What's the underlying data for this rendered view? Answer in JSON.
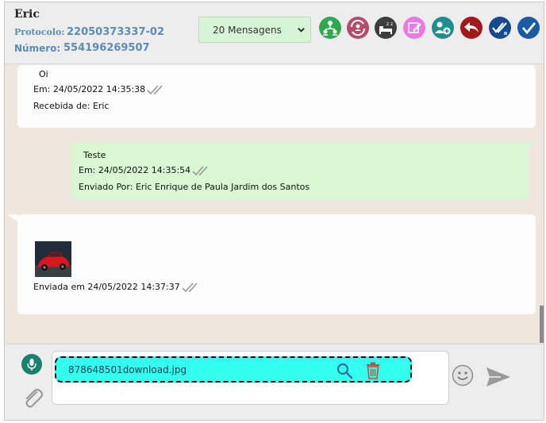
{
  "header": {
    "contact_name": "Eric",
    "protocol_label": "Protocolo:",
    "protocol_value": "22050373337-02",
    "number_label": "Número:",
    "number_value": "554196269507",
    "messages_select": "20 Mensagens",
    "toolbar_icons": [
      "transfer-icon",
      "sync-person-icon",
      "sleep-icon",
      "edit-note-icon",
      "add-contact-icon",
      "reply-icon",
      "double-check-icon",
      "check-icon"
    ],
    "toolbar_colors": [
      "#2fa84f",
      "#b54a6a",
      "#3d3d3d",
      "#e879e8",
      "#1e8f8c",
      "#a31818",
      "#174a8c",
      "#1a5aa6"
    ]
  },
  "messages": [
    {
      "direction": "in",
      "text": "Oi",
      "timestamp": "Em: 24/05/2022 14:35:38",
      "meta": "Recebida de: Eric"
    },
    {
      "direction": "out",
      "text": "Teste",
      "timestamp": "Em: 24/05/2022 14:35:54",
      "meta": "Enviado Por: Eric Enrique de Paula Jardim dos Santos"
    },
    {
      "direction": "in",
      "attachment": "image",
      "timestamp": "Enviada em 24/05/2022 14:37:37"
    }
  ],
  "composer": {
    "file_name": "878648501download.jpg",
    "accent": "#33ffee"
  }
}
